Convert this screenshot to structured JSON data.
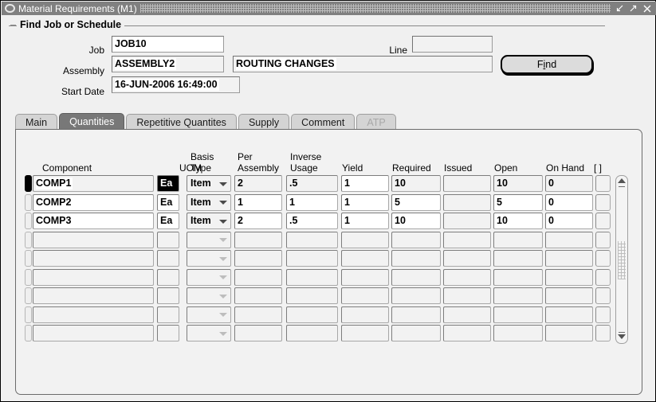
{
  "window": {
    "title": "Material Requirements (M1)",
    "controls": [
      {
        "name": "minimize",
        "glyph": "minimize-icon"
      },
      {
        "name": "maximize",
        "glyph": "maximize-icon"
      },
      {
        "name": "close",
        "glyph": "close-icon"
      }
    ]
  },
  "find_group": {
    "title": "Find Job or Schedule",
    "fields": {
      "job_label": "Job",
      "job_value": "JOB10",
      "line_label": "Line",
      "line_value": "",
      "assembly_label": "Assembly",
      "assembly_value": "ASSEMBLY2",
      "assembly_desc_value": "ROUTING CHANGES",
      "start_date_label": "Start Date",
      "start_date_value": "16-JUN-2006 16:49:00"
    },
    "find_button": {
      "label_before": "F",
      "label_mnemonic": "i",
      "label_after": "nd",
      "label": "Find"
    }
  },
  "tabs": [
    {
      "label": "Main",
      "selected": false,
      "disabled": false
    },
    {
      "label": "Quantities",
      "selected": true,
      "disabled": false
    },
    {
      "label": "Repetitive Quantites",
      "selected": false,
      "disabled": false
    },
    {
      "label": "Supply",
      "selected": false,
      "disabled": false
    },
    {
      "label": "Comment",
      "selected": false,
      "disabled": false
    },
    {
      "label": "ATP",
      "selected": false,
      "disabled": true
    }
  ],
  "grid": {
    "headers": {
      "component": "Component",
      "uom": "UOM",
      "basis_type_1": "Basis",
      "basis_type_2": "Type",
      "per_assembly_1": "Per",
      "per_assembly_2": "Assembly",
      "inverse_usage_1": "Inverse",
      "inverse_usage_2": "Usage",
      "yield": "Yield",
      "required": "Required",
      "issued": "Issued",
      "open": "Open",
      "on_hand": "On Hand",
      "flag": "[ ]"
    },
    "rows": [
      {
        "current": true,
        "component": "COMP1",
        "uom": "Ea",
        "uom_focused": true,
        "basis_type": "Item",
        "per_assembly": "2",
        "inverse_usage": ".5",
        "yield": "1",
        "required": "10",
        "issued": "",
        "open": "10",
        "on_hand": "0",
        "flag": ""
      },
      {
        "current": false,
        "component": "COMP2",
        "uom": "Ea",
        "uom_focused": false,
        "basis_type": "Item",
        "per_assembly": "1",
        "inverse_usage": "1",
        "yield": "1",
        "required": "5",
        "issued": "",
        "open": "5",
        "on_hand": "0",
        "flag": ""
      },
      {
        "current": false,
        "component": "COMP3",
        "uom": "Ea",
        "uom_focused": false,
        "basis_type": "Item",
        "per_assembly": "2",
        "inverse_usage": ".5",
        "yield": "1",
        "required": "10",
        "issued": "",
        "open": "10",
        "on_hand": "0",
        "flag": ""
      },
      {
        "current": false,
        "component": "",
        "uom": "",
        "uom_focused": false,
        "basis_type": "",
        "per_assembly": "",
        "inverse_usage": "",
        "yield": "",
        "required": "",
        "issued": "",
        "open": "",
        "on_hand": "",
        "flag": ""
      },
      {
        "current": false,
        "component": "",
        "uom": "",
        "uom_focused": false,
        "basis_type": "",
        "per_assembly": "",
        "inverse_usage": "",
        "yield": "",
        "required": "",
        "issued": "",
        "open": "",
        "on_hand": "",
        "flag": ""
      },
      {
        "current": false,
        "component": "",
        "uom": "",
        "uom_focused": false,
        "basis_type": "",
        "per_assembly": "",
        "inverse_usage": "",
        "yield": "",
        "required": "",
        "issued": "",
        "open": "",
        "on_hand": "",
        "flag": ""
      },
      {
        "current": false,
        "component": "",
        "uom": "",
        "uom_focused": false,
        "basis_type": "",
        "per_assembly": "",
        "inverse_usage": "",
        "yield": "",
        "required": "",
        "issued": "",
        "open": "",
        "on_hand": "",
        "flag": ""
      },
      {
        "current": false,
        "component": "",
        "uom": "",
        "uom_focused": false,
        "basis_type": "",
        "per_assembly": "",
        "inverse_usage": "",
        "yield": "",
        "required": "",
        "issued": "",
        "open": "",
        "on_hand": "",
        "flag": ""
      },
      {
        "current": false,
        "component": "",
        "uom": "",
        "uom_focused": false,
        "basis_type": "",
        "per_assembly": "",
        "inverse_usage": "",
        "yield": "",
        "required": "",
        "issued": "",
        "open": "",
        "on_hand": "",
        "flag": ""
      }
    ]
  },
  "colors": {
    "titlebar": "#808080",
    "window_bg": "#f0f0f0",
    "panel_bg": "#f2f2f2",
    "selected_tab": "#787878",
    "tab_bg": "#d4d4d4",
    "field_bg": "#f2f2f2",
    "field_white": "#ffffff",
    "focus_bg": "#000000"
  }
}
